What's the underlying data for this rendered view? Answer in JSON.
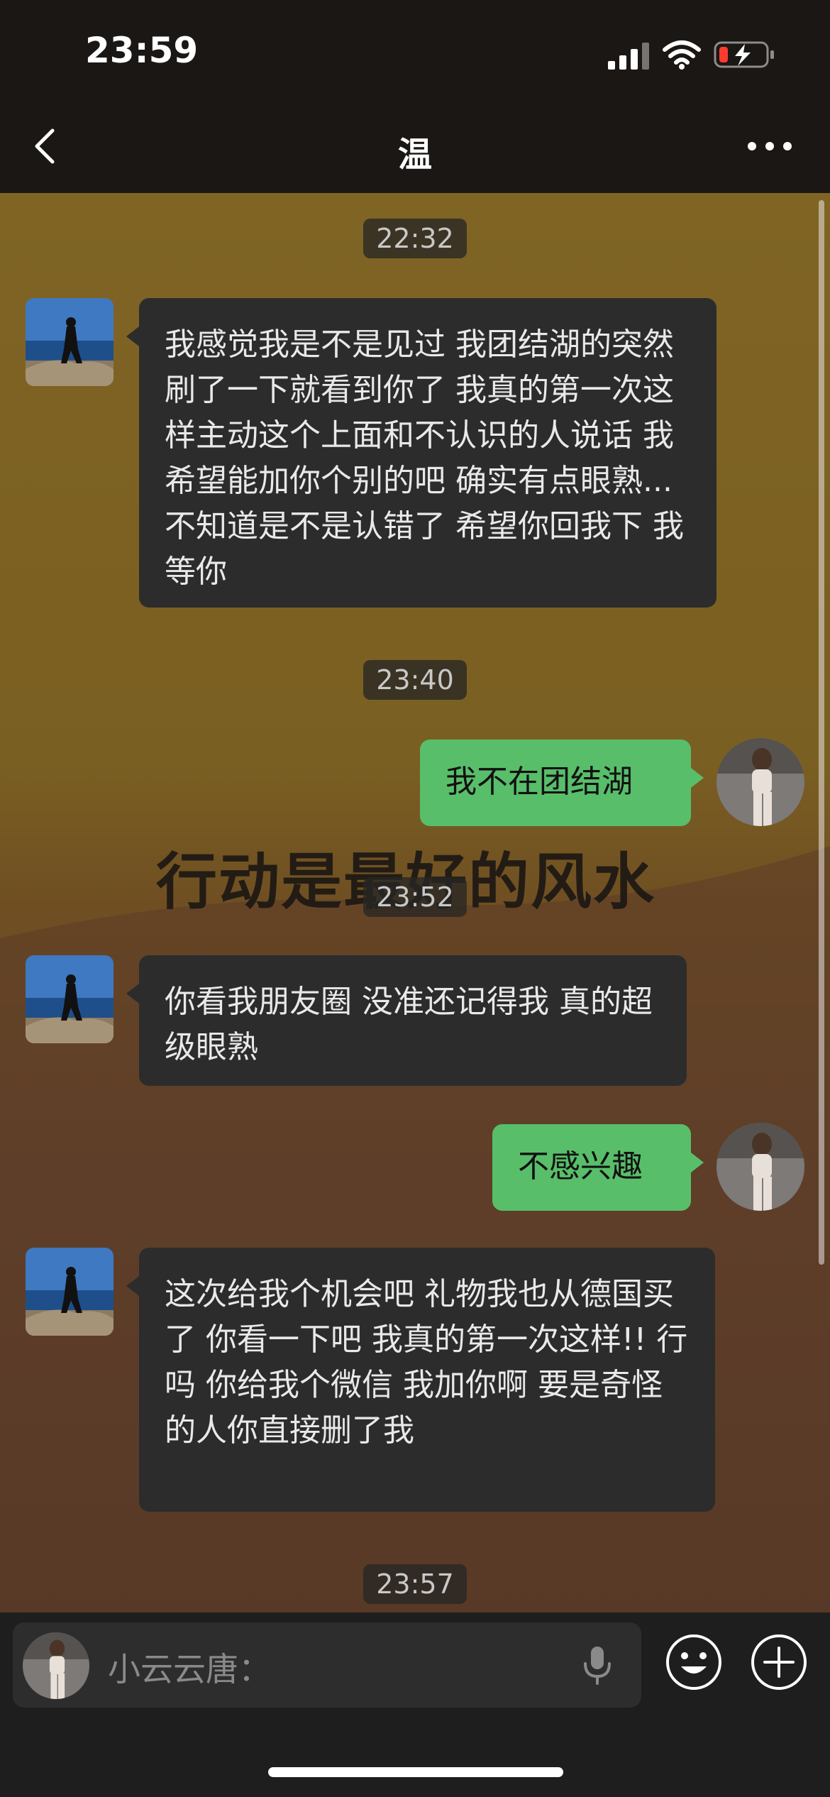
{
  "status_bar": {
    "time": "23:59"
  },
  "header": {
    "title": "温"
  },
  "wallpaper_text": "行动是最好的风水",
  "messages": [
    {
      "type": "time",
      "text": "22:32"
    },
    {
      "type": "in",
      "text": "我感觉我是不是见过 我团结湖的突然刷了一下就看到你了 我真的第一次这样主动这个上面和不认识的人说话 我希望能加你个别的吧 确实有点眼熟... 不知道是不是认错了 希望你回我下 我等你"
    },
    {
      "type": "time",
      "text": "23:40"
    },
    {
      "type": "out",
      "text": "我不在团结湖"
    },
    {
      "type": "time",
      "text": "23:52"
    },
    {
      "type": "in",
      "text": "你看我朋友圈 没准还记得我 真的超级眼熟"
    },
    {
      "type": "out",
      "text": "不感兴趣"
    },
    {
      "type": "in",
      "text": "这次给我个机会吧 礼物我也从德国买了 你看一下吧 我真的第一次这样!! 行吗 你给我个微信 我加你啊 要是奇怪的人你直接删了我"
    },
    {
      "type": "time",
      "text": "23:57"
    }
  ],
  "input": {
    "placeholder": "小云云唐："
  },
  "icons": {
    "back": "chevron-left-icon",
    "more": "ellipsis-icon",
    "voice": "microphone-icon",
    "emoji": "smiley-icon",
    "plus": "plus-circle-icon"
  },
  "colors": {
    "outgoing_bubble": "#58be6a",
    "incoming_bubble": "#2c2c2c",
    "header_bg": "#1b1714"
  }
}
